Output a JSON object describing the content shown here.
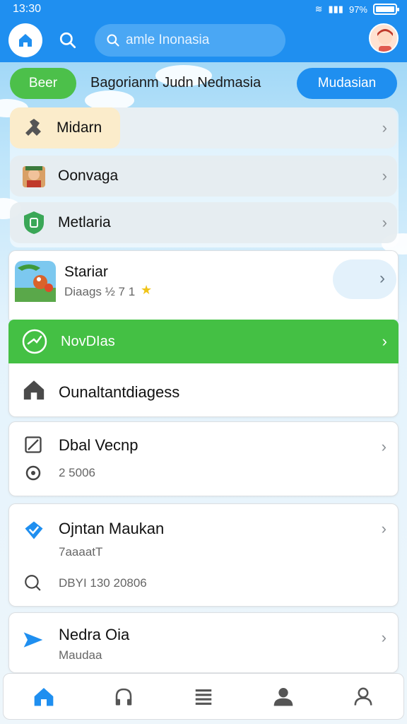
{
  "status": {
    "time": "13:30",
    "battery": "97%"
  },
  "header": {
    "search_text": "amle Inonasia"
  },
  "chips": {
    "left": "Beer",
    "title": "Bagorianm Judn  Nedmasia",
    "right": "Mudasian"
  },
  "menu": {
    "items": [
      {
        "label": "Midarn",
        "icon": "tool-icon"
      },
      {
        "label": "Oonvaga",
        "icon": "character-icon"
      },
      {
        "label": "Metlaria",
        "icon": "shield-icon"
      }
    ]
  },
  "featured": {
    "title": "Stariar",
    "subtitle": "Diaags ½ 7 1"
  },
  "green_bar": {
    "label": "NovDIas"
  },
  "card_main": {
    "label": "Ounaltantdiagess"
  },
  "cards": [
    {
      "title": "Dbal Vecnp",
      "meta": "2 5006"
    },
    {
      "title": "Ojntan Maukan",
      "sub": "7aaaatT",
      "meta": "DBYI 130 20806"
    },
    {
      "title": "Nedra Oia",
      "sub": "Maudaa"
    }
  ],
  "colors": {
    "primary": "#1f8ff0",
    "green": "#44c044",
    "card_bg": "#ffffff"
  }
}
